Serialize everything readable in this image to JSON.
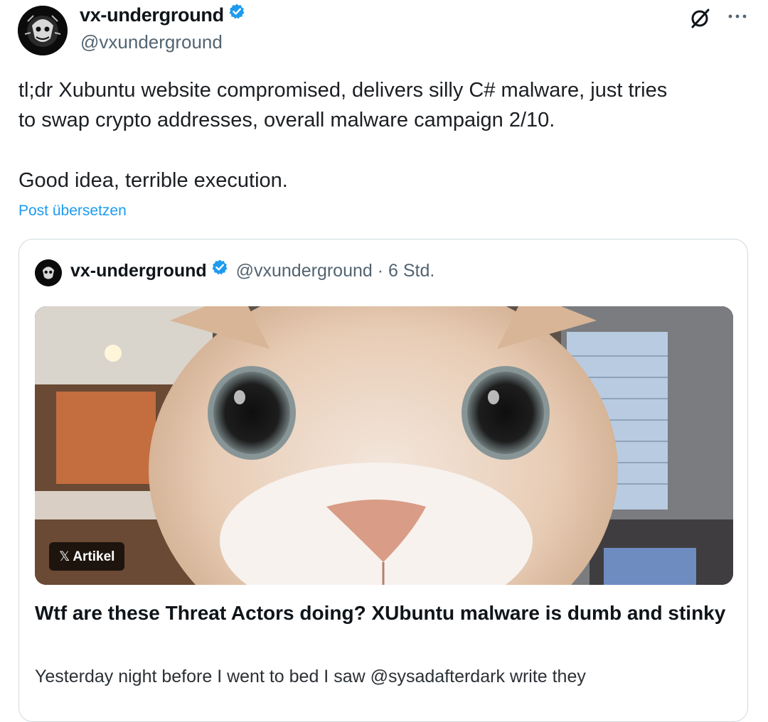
{
  "post": {
    "author_name": "vx-underground",
    "author_handle": "@vxunderground",
    "text_lines": [
      "tl;dr Xubuntu website compromised, delivers silly C# malware, just tries",
      "to swap crypto addresses, overall malware campaign 2/10."
    ],
    "text_second_paragraph": "Good idea, terrible execution.",
    "translate_link": "Post übersetzen",
    "icons": {
      "grok": "grok-icon",
      "more": "more-options-icon",
      "verified": "verified-badge-icon"
    }
  },
  "quote": {
    "author_name": "vx-underground",
    "author_handle": "@vxunderground",
    "separator": " · ",
    "timestamp": "6 Std.",
    "media_badge": "Artikel",
    "article_title": "Wtf are these Threat Actors doing? XUbuntu malware is dumb and stinky",
    "article_excerpt": "Yesterday night before I went to bed I saw @sysadafterdark write they"
  },
  "colors": {
    "link": "#1d9bf0",
    "verified": "#1d9bf0",
    "secondary_text": "#536471",
    "border": "#cfd9de"
  }
}
